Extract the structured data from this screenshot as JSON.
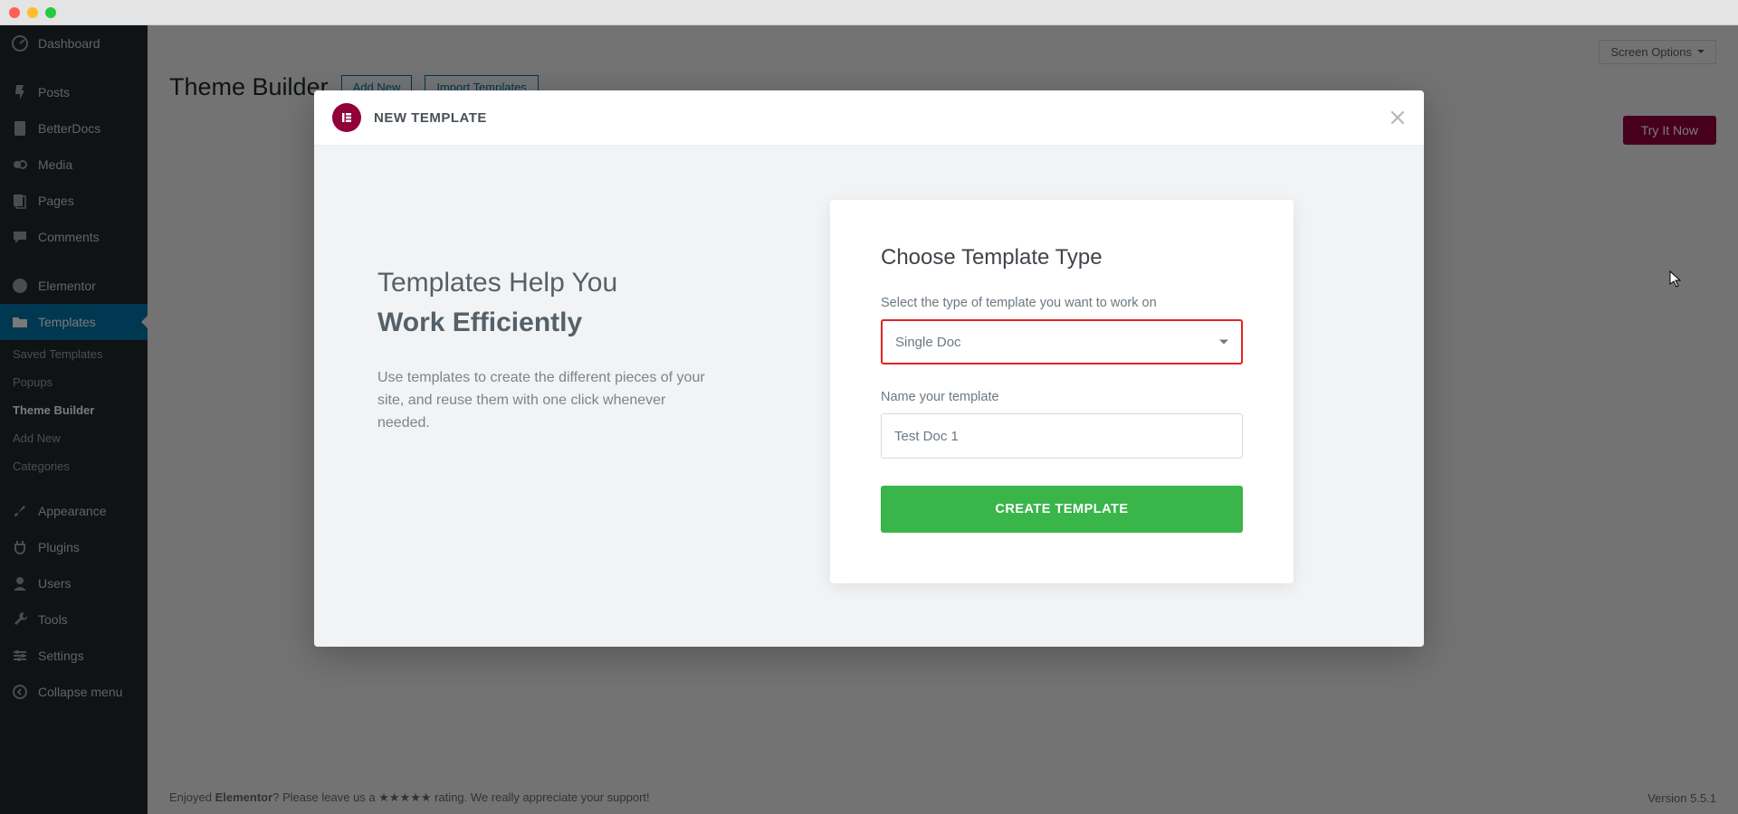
{
  "sidebar": {
    "items": [
      {
        "label": "Dashboard"
      },
      {
        "label": "Posts"
      },
      {
        "label": "BetterDocs"
      },
      {
        "label": "Media"
      },
      {
        "label": "Pages"
      },
      {
        "label": "Comments"
      },
      {
        "label": "Elementor"
      },
      {
        "label": "Templates"
      },
      {
        "label": "Appearance"
      },
      {
        "label": "Plugins"
      },
      {
        "label": "Users"
      },
      {
        "label": "Tools"
      },
      {
        "label": "Settings"
      },
      {
        "label": "Collapse menu"
      }
    ],
    "subs": [
      {
        "label": "Saved Templates"
      },
      {
        "label": "Popups"
      },
      {
        "label": "Theme Builder"
      },
      {
        "label": "Add New"
      },
      {
        "label": "Categories"
      }
    ]
  },
  "topbar": {
    "screen_options": "Screen Options"
  },
  "page": {
    "title": "Theme Builder",
    "add_new": "Add New",
    "import": "Import Templates"
  },
  "cta": {
    "label": "Try It Now"
  },
  "footer": {
    "prefix": "Enjoyed ",
    "brand": "Elementor",
    "mid": "? Please leave us a ",
    "stars": "★★★★★",
    "suffix": " rating. We really appreciate your support!",
    "version": "Version 5.5.1"
  },
  "modal": {
    "title": "NEW TEMPLATE",
    "logo_text": "E",
    "intro_line1": "Templates Help You",
    "intro_line2": "Work Efficiently",
    "intro_desc": "Use templates to create the different pieces of your site, and reuse them with one click whenever needed.",
    "card_title": "Choose Template Type",
    "select_label": "Select the type of template you want to work on",
    "select_value": "Single Doc",
    "name_label": "Name your template",
    "name_value": "Test Doc 1",
    "create_label": "CREATE TEMPLATE"
  }
}
